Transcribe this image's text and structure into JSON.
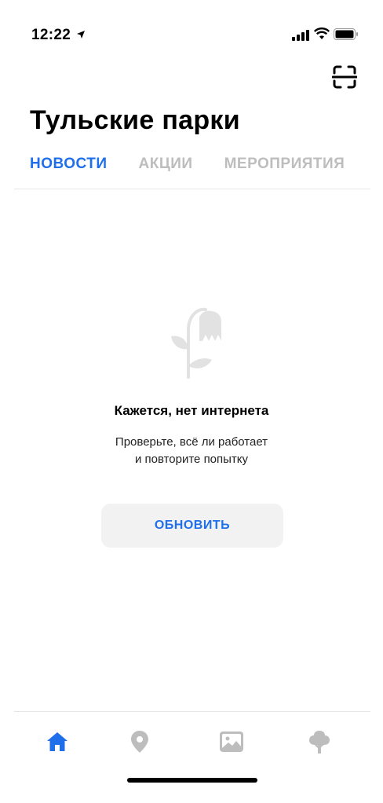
{
  "status_bar": {
    "time": "12:22"
  },
  "header": {
    "title": "Тульские парки"
  },
  "tabs": [
    {
      "label": "НОВОСТИ",
      "active": true
    },
    {
      "label": "АКЦИИ",
      "active": false
    },
    {
      "label": "МЕРОПРИЯТИЯ",
      "active": false
    }
  ],
  "empty_state": {
    "icon": "wilted-flower-icon",
    "title": "Кажется, нет интернета",
    "message_line1": "Проверьте, всё ли работает",
    "message_line2": "и повторите попытку",
    "button_label": "ОБНОВИТЬ"
  },
  "tabbar": [
    {
      "icon": "home-icon",
      "active": true
    },
    {
      "icon": "map-pin-icon",
      "active": false
    },
    {
      "icon": "gallery-icon",
      "active": false
    },
    {
      "icon": "tree-icon",
      "active": false
    }
  ],
  "colors": {
    "accent": "#1f6feb",
    "inactive": "#bdbdbd",
    "button_bg": "#f2f2f2"
  }
}
